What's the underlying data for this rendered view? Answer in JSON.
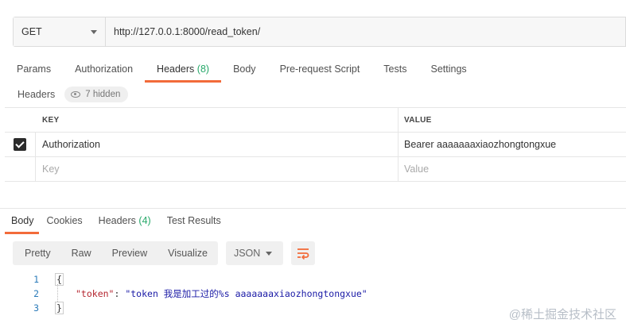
{
  "request": {
    "method": "GET",
    "url": "http://127.0.0.1:8000/read_token/"
  },
  "request_tabs": [
    {
      "label": "Params",
      "count": ""
    },
    {
      "label": "Authorization",
      "count": ""
    },
    {
      "label": "Headers",
      "count": "(8)"
    },
    {
      "label": "Body",
      "count": ""
    },
    {
      "label": "Pre-request Script",
      "count": ""
    },
    {
      "label": "Tests",
      "count": ""
    },
    {
      "label": "Settings",
      "count": ""
    }
  ],
  "active_request_tab": "Headers",
  "headers_section": {
    "label": "Headers",
    "hidden_label": "7 hidden"
  },
  "headers_table": {
    "columns": [
      "KEY",
      "VALUE"
    ],
    "rows": [
      {
        "checked": true,
        "key": "Authorization",
        "value": "Bearer aaaaaaaxiaozhongtongxue"
      }
    ],
    "placeholder": {
      "key": "Key",
      "value": "Value"
    }
  },
  "response_tabs": [
    {
      "label": "Body",
      "count": ""
    },
    {
      "label": "Cookies",
      "count": ""
    },
    {
      "label": "Headers",
      "count": "(4)"
    },
    {
      "label": "Test Results",
      "count": ""
    }
  ],
  "active_response_tab": "Body",
  "response_view": {
    "modes": [
      "Pretty",
      "Raw",
      "Preview",
      "Visualize"
    ],
    "active_mode": "Pretty",
    "format": "JSON"
  },
  "response_body": {
    "lines": [
      {
        "num": "1",
        "text": "{"
      },
      {
        "num": "2",
        "key": "\"token\"",
        "sep": ": ",
        "value": "\"token 我是加工过的%s aaaaaaaxiaozhongtongxue\""
      },
      {
        "num": "3",
        "text": "}"
      }
    ]
  },
  "watermark": "@稀土掘金技术社区",
  "colors": {
    "accent": "#f26b3a",
    "count_green": "#26a869",
    "json_key": "#b4242e",
    "json_string": "#1a1aa6",
    "line_number": "#2b7bb9"
  }
}
